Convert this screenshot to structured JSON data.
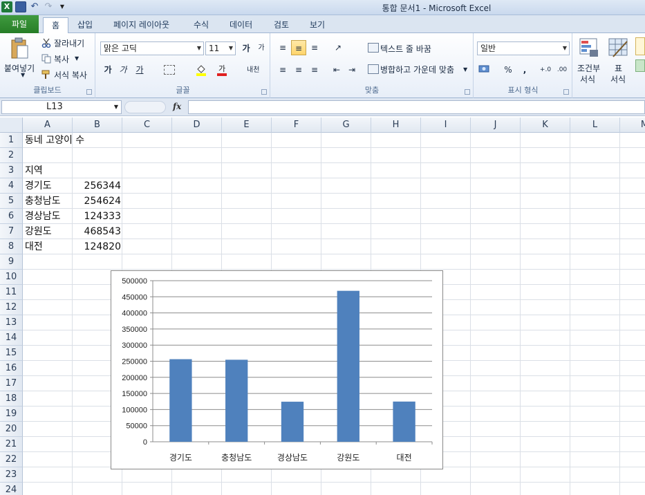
{
  "window": {
    "title": "통합 문서1  -  Microsoft Excel"
  },
  "qat": {
    "logo_text": "X",
    "undo": "↶",
    "redo": "↷"
  },
  "tabs": [
    {
      "label": "파일"
    },
    {
      "label": "홈"
    },
    {
      "label": "삽입"
    },
    {
      "label": "페이지 레이아웃"
    },
    {
      "label": "수식"
    },
    {
      "label": "데이터"
    },
    {
      "label": "검토"
    },
    {
      "label": "보기"
    }
  ],
  "ribbon": {
    "clipboard": {
      "paste": "붙여넣기",
      "cut": "잘라내기",
      "copy": "복사",
      "format_painter": "서식 복사",
      "label": "클립보드"
    },
    "font": {
      "name": "맑은 고딕",
      "size": "11",
      "grow": "가",
      "shrink": "가",
      "bold": "가",
      "italic": "가",
      "underline": "가",
      "phonetic": "내천",
      "label": "글꼴"
    },
    "alignment": {
      "wrap_text": "텍스트 줄 바꿈",
      "merge_center": "병합하고 가운데 맞춤",
      "label": "맞춤"
    },
    "number": {
      "format": "일반",
      "percent": "%",
      "comma": ",",
      "inc_decimal": "+.0",
      "dec_decimal": ".00",
      "label": "표시 형식"
    },
    "styles": {
      "conditional": "조건부",
      "conditional2": "서식",
      "table": "표",
      "table2": "서식"
    }
  },
  "formula_bar": {
    "name_box": "L13",
    "fx": "fx",
    "value": ""
  },
  "sheet": {
    "columns": [
      "A",
      "B",
      "C",
      "D",
      "E",
      "F",
      "G",
      "H",
      "I",
      "J",
      "K",
      "L",
      "M"
    ],
    "rows": [
      "1",
      "2",
      "3",
      "4",
      "5",
      "6",
      "7",
      "8",
      "9",
      "10",
      "11",
      "12",
      "13",
      "14",
      "15",
      "16",
      "17",
      "18",
      "19",
      "20",
      "21",
      "22",
      "23",
      "24"
    ],
    "title_cell": "동네 고양이 수",
    "header_cell": "지역",
    "data": [
      {
        "region": "경기도",
        "count": "256344"
      },
      {
        "region": "충청남도",
        "count": "254624"
      },
      {
        "region": "경상남도",
        "count": "124333"
      },
      {
        "region": "강원도",
        "count": "468543"
      },
      {
        "region": "대전",
        "count": "124820"
      }
    ]
  },
  "chart_data": {
    "type": "bar",
    "categories": [
      "경기도",
      "충청남도",
      "경상남도",
      "강원도",
      "대전"
    ],
    "values": [
      256344,
      254624,
      124333,
      468543,
      124820
    ],
    "ylim": [
      0,
      500000
    ],
    "yticks": [
      "0",
      "50000",
      "100000",
      "150000",
      "200000",
      "250000",
      "300000",
      "350000",
      "400000",
      "450000",
      "500000"
    ],
    "grid": true,
    "legend": "none",
    "bar_color": "#4f81bd"
  }
}
